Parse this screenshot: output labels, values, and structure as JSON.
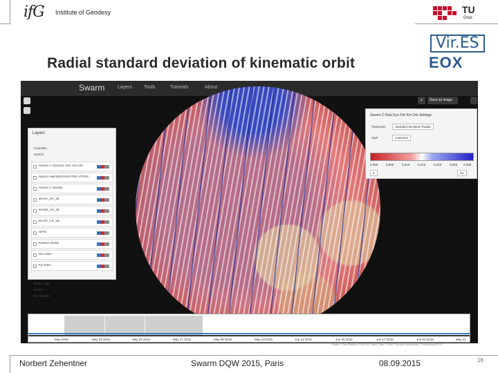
{
  "header": {
    "institute_logo": "ifG",
    "institute_name": "Institute of Geodesy",
    "university_logo": "TU",
    "university_sub": "Graz"
  },
  "slide": {
    "title": "Radial standard deviation of kinematic orbit"
  },
  "partner_logos": {
    "vires": "Vir.ES",
    "eox": "EOX"
  },
  "app": {
    "brand": "Swarm",
    "nav": [
      "Layers",
      "Tools",
      "Tutorials",
      "About"
    ],
    "save_button": "Save as image",
    "layers_panel": {
      "title": "Layers",
      "base": [
        "Coastline",
        "Stretch"
      ],
      "items": [
        "Swarm C Rad.Dyn.Orb. Kin.Orb",
        "Swarm A&B BREAKIN PRE-ATTEM",
        "Swarm C Density",
        "MAGA_LR_1B",
        "MAGB_LR_1B",
        "MAGC_LR_1B",
        "SIFM",
        "Eastern Model",
        "Dst Index",
        "Kp Index"
      ],
      "radios": [
        "Terrain Light",
        "Terrain",
        "Blue Marble"
      ]
    },
    "settings_panel": {
      "title": "Swarm C Rad.Dyn.Orb Kin.Orb Settings",
      "parameter_label": "Parameter",
      "parameter_value": "Standard deviation Radial",
      "style_label": "Style",
      "style_value": "coolwarm",
      "ticks": [
        "0.000",
        "0.005",
        "0.010",
        "0.015",
        "0.020",
        "0.025",
        "0.030"
      ],
      "range_min": "0",
      "range_max": "NA"
    },
    "timeline": {
      "labels": [
        "May 2005",
        "May 03 2015",
        "May 25 2015",
        "May 17 2015",
        "May 08 2015",
        "May 13 2015",
        "Jun 13 2015",
        "Jun 25 2015",
        "Jun 17 2015",
        "Jun 03 2015",
        "May 21"
      ]
    },
    "credits": "Swarm · Dos Retrieve: ESA/GA Planet. Data © Orbit Overview contributors, Frederickson/EOX"
  },
  "footer": {
    "author": "Norbert Zehentner",
    "event": "Swarm DQW 2015, Paris",
    "date": "08.09.2015",
    "page": "16"
  }
}
